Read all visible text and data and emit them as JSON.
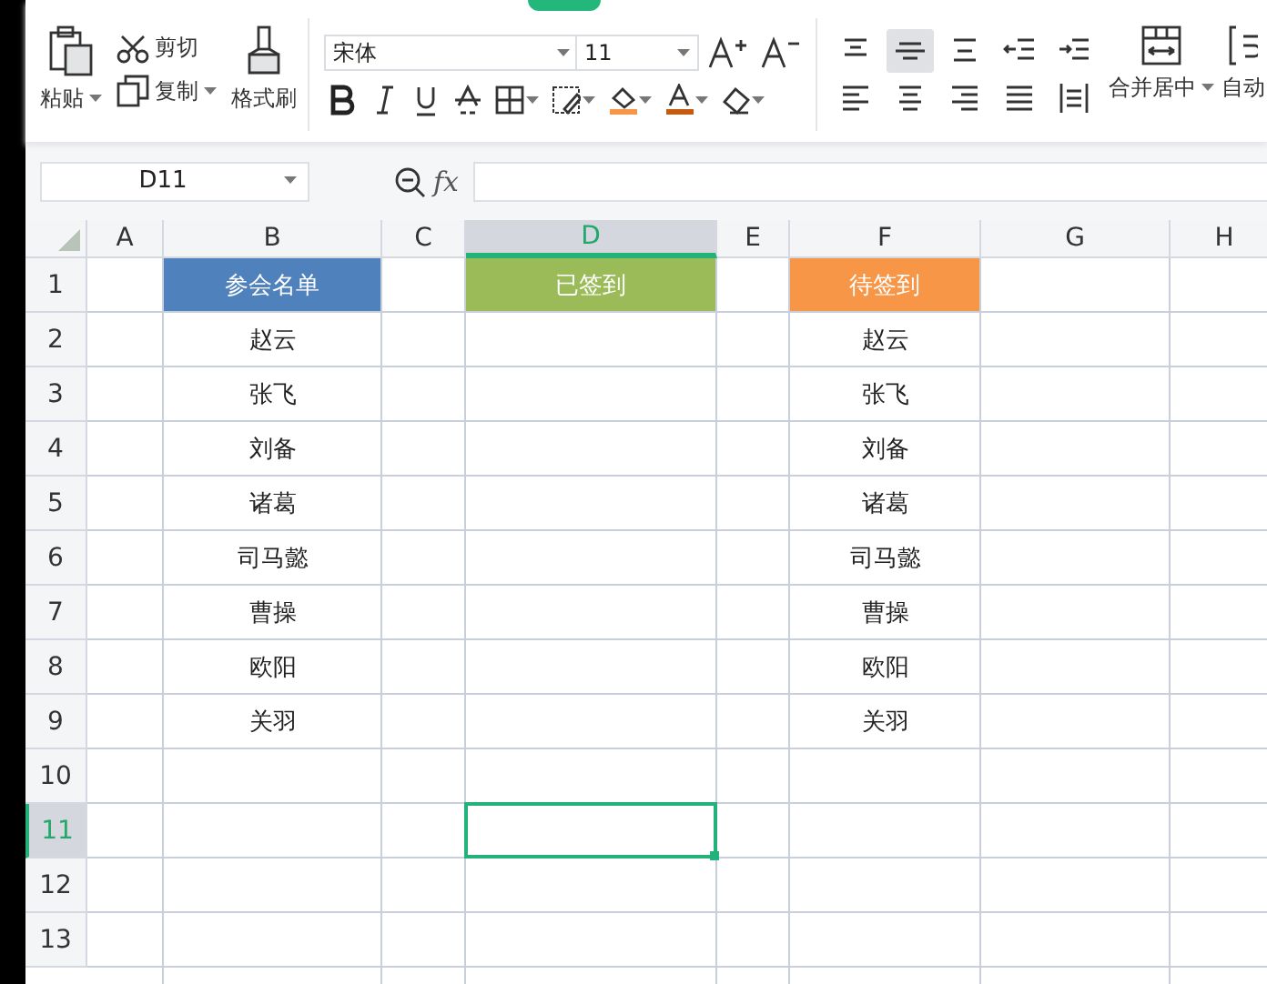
{
  "ribbon": {
    "paste": "粘贴",
    "cut": "剪切",
    "copy": "复制",
    "format_painter": "格式刷",
    "font_name": "宋体",
    "font_size": "11",
    "merge_center": "合并居中",
    "auto_wrap": "自动",
    "align_buttons": [
      {
        "kind": "top",
        "selected": false
      },
      {
        "kind": "middle",
        "selected": true
      },
      {
        "kind": "bottom",
        "selected": false
      },
      {
        "kind": "outdent",
        "selected": false
      },
      {
        "kind": "indent",
        "selected": false
      },
      {
        "kind": "left",
        "selected": false
      },
      {
        "kind": "center",
        "selected": false
      },
      {
        "kind": "right",
        "selected": false
      },
      {
        "kind": "justify",
        "selected": false
      },
      {
        "kind": "distribute",
        "selected": false
      }
    ]
  },
  "formula_bar": {
    "name_box": "D11",
    "fx": "fx"
  },
  "sheet": {
    "columns": [
      {
        "label": "A",
        "selected": false
      },
      {
        "label": "B",
        "selected": false
      },
      {
        "label": "C",
        "selected": false
      },
      {
        "label": "D",
        "selected": true
      },
      {
        "label": "E",
        "selected": false
      },
      {
        "label": "F",
        "selected": false
      },
      {
        "label": "G",
        "selected": false
      },
      {
        "label": "H",
        "selected": false
      }
    ],
    "rows": [
      {
        "label": "1",
        "selected": false,
        "cells": [
          null,
          {
            "text": "参会名单",
            "color": "#4f81bd"
          },
          null,
          {
            "text": "已签到",
            "color": "#9bbb59"
          },
          null,
          {
            "text": "待签到",
            "color": "#f79646"
          }
        ]
      },
      {
        "label": "2",
        "selected": false,
        "cells": [
          null,
          {
            "text": "赵云"
          },
          null,
          null,
          null,
          {
            "text": "赵云"
          }
        ]
      },
      {
        "label": "3",
        "selected": false,
        "cells": [
          null,
          {
            "text": "张飞"
          },
          null,
          null,
          null,
          {
            "text": "张飞"
          }
        ]
      },
      {
        "label": "4",
        "selected": false,
        "cells": [
          null,
          {
            "text": "刘备"
          },
          null,
          null,
          null,
          {
            "text": "刘备"
          }
        ]
      },
      {
        "label": "5",
        "selected": false,
        "cells": [
          null,
          {
            "text": "诸葛"
          },
          null,
          null,
          null,
          {
            "text": "诸葛"
          }
        ]
      },
      {
        "label": "6",
        "selected": false,
        "cells": [
          null,
          {
            "text": "司马懿"
          },
          null,
          null,
          null,
          {
            "text": "司马懿"
          }
        ]
      },
      {
        "label": "7",
        "selected": false,
        "cells": [
          null,
          {
            "text": "曹操"
          },
          null,
          null,
          null,
          {
            "text": "曹操"
          }
        ]
      },
      {
        "label": "8",
        "selected": false,
        "cells": [
          null,
          {
            "text": "欧阳"
          },
          null,
          null,
          null,
          {
            "text": "欧阳"
          }
        ]
      },
      {
        "label": "9",
        "selected": false,
        "cells": [
          null,
          {
            "text": "关羽"
          },
          null,
          null,
          null,
          {
            "text": "关羽"
          }
        ]
      },
      {
        "label": "10",
        "selected": false
      },
      {
        "label": "11",
        "selected": true,
        "cells": [
          null,
          null,
          null,
          {
            "active": true
          }
        ]
      },
      {
        "label": "12",
        "selected": false
      },
      {
        "label": "13",
        "selected": false
      }
    ]
  }
}
